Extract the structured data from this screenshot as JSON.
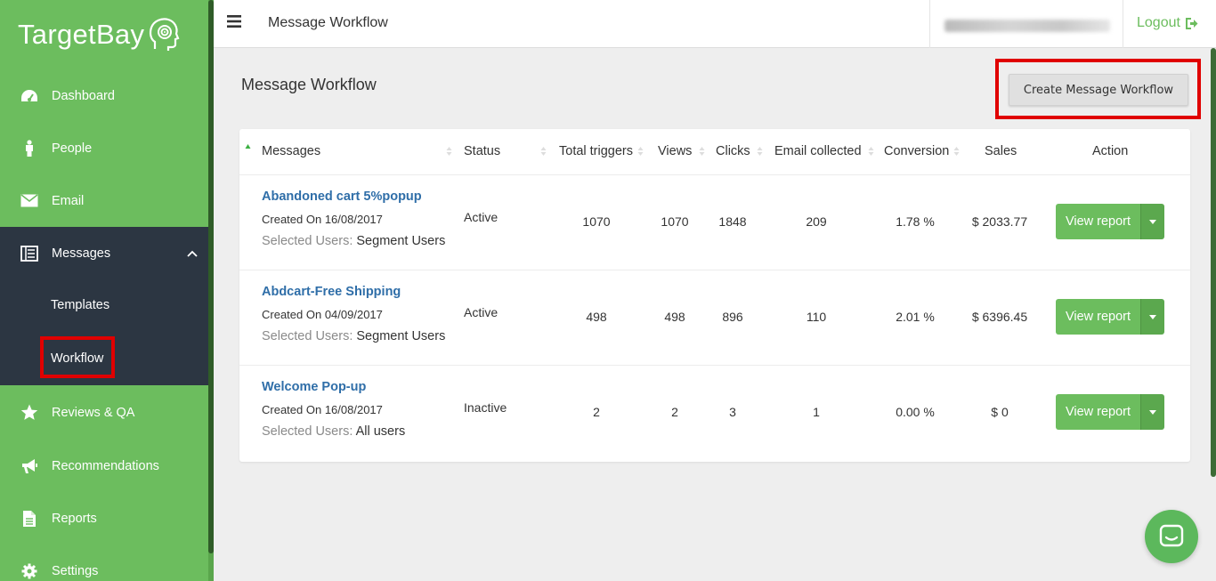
{
  "brand": {
    "name": "TargetBay",
    "green": "#6cbd5e",
    "dark": "#2c3642",
    "link": "#2f6ea8",
    "highlight": "#e00000"
  },
  "sidebar": {
    "items": [
      {
        "label": "Dashboard",
        "icon": "dashboard-icon"
      },
      {
        "label": "People",
        "icon": "person-icon"
      },
      {
        "label": "Email",
        "icon": "envelope-icon"
      },
      {
        "label": "Messages",
        "icon": "messages-icon",
        "expanded": true
      },
      {
        "label": "Reviews & QA",
        "icon": "star-icon"
      },
      {
        "label": "Recommendations",
        "icon": "megaphone-icon"
      },
      {
        "label": "Reports",
        "icon": "document-icon"
      },
      {
        "label": "Settings",
        "icon": "gear-icon"
      }
    ],
    "messages_sub": {
      "templates": "Templates",
      "workflow": "Workflow"
    }
  },
  "topbar": {
    "title": "Message Workflow",
    "logout": "Logout"
  },
  "page": {
    "title": "Message Workflow",
    "create_button": "Create Message Workflow"
  },
  "table": {
    "headers": {
      "messages": "Messages",
      "status": "Status",
      "total_triggers": "Total triggers",
      "views": "Views",
      "clicks": "Clicks",
      "email_collected": "Email collected",
      "conversion": "Conversion",
      "sales": "Sales",
      "action": "Action"
    },
    "selected_users_label": "Selected Users:",
    "view_report": "View report",
    "rows": [
      {
        "name": "Abandoned cart 5%popup",
        "created": "Created On 16/08/2017",
        "users": "Segment Users",
        "status": "Active",
        "triggers": "1070",
        "views": "1070",
        "clicks": "1848",
        "emails": "209",
        "conversion": "1.78 %",
        "sales": "$ 2033.77"
      },
      {
        "name": "Abdcart-Free Shipping",
        "created": "Created On 04/09/2017",
        "users": "Segment Users",
        "status": "Active",
        "triggers": "498",
        "views": "498",
        "clicks": "896",
        "emails": "110",
        "conversion": "2.01 %",
        "sales": "$ 6396.45"
      },
      {
        "name": "Welcome Pop-up",
        "created": "Created On 16/08/2017",
        "users": "All users",
        "status": "Inactive",
        "triggers": "2",
        "views": "2",
        "clicks": "3",
        "emails": "1",
        "conversion": "0.00 %",
        "sales": "$ 0"
      }
    ]
  }
}
